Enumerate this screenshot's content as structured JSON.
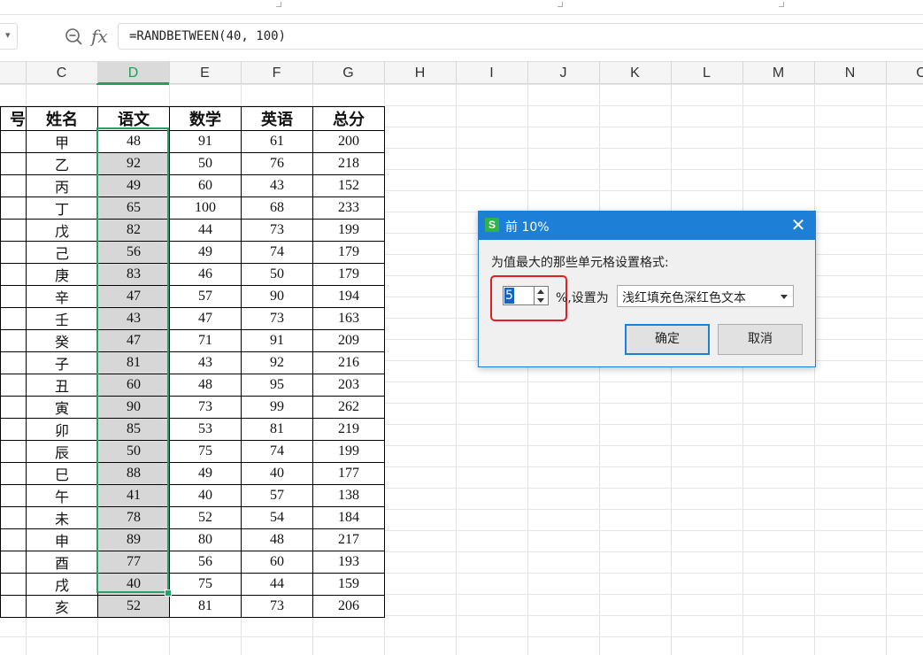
{
  "formula_bar": {
    "formula": "=RANDBETWEEN(40, 100)",
    "fx_label": "fx",
    "name_box_arrow": "▾"
  },
  "columns": [
    "C",
    "D",
    "E",
    "F",
    "G",
    "H",
    "I",
    "J",
    "K",
    "L",
    "M",
    "N",
    "O"
  ],
  "active_column": "D",
  "table": {
    "header_cut": "号",
    "headers": [
      "姓名",
      "语文",
      "数学",
      "英语",
      "总分"
    ],
    "rows": [
      [
        "甲",
        "48",
        "91",
        "61",
        "200"
      ],
      [
        "乙",
        "92",
        "50",
        "76",
        "218"
      ],
      [
        "丙",
        "49",
        "60",
        "43",
        "152"
      ],
      [
        "丁",
        "65",
        "100",
        "68",
        "233"
      ],
      [
        "戊",
        "82",
        "44",
        "73",
        "199"
      ],
      [
        "己",
        "56",
        "49",
        "74",
        "179"
      ],
      [
        "庚",
        "83",
        "46",
        "50",
        "179"
      ],
      [
        "辛",
        "47",
        "57",
        "90",
        "194"
      ],
      [
        "壬",
        "43",
        "47",
        "73",
        "163"
      ],
      [
        "癸",
        "47",
        "71",
        "91",
        "209"
      ],
      [
        "子",
        "81",
        "43",
        "92",
        "216"
      ],
      [
        "丑",
        "60",
        "48",
        "95",
        "203"
      ],
      [
        "寅",
        "90",
        "73",
        "99",
        "262"
      ],
      [
        "卯",
        "85",
        "53",
        "81",
        "219"
      ],
      [
        "辰",
        "50",
        "75",
        "74",
        "199"
      ],
      [
        "巳",
        "88",
        "49",
        "40",
        "177"
      ],
      [
        "午",
        "41",
        "40",
        "57",
        "138"
      ],
      [
        "未",
        "78",
        "52",
        "54",
        "184"
      ],
      [
        "申",
        "89",
        "80",
        "48",
        "217"
      ],
      [
        "酉",
        "77",
        "56",
        "60",
        "193"
      ],
      [
        "戌",
        "40",
        "75",
        "44",
        "159"
      ],
      [
        "亥",
        "52",
        "81",
        "73",
        "206"
      ]
    ]
  },
  "dialog": {
    "logo": "S",
    "title": "前 10%",
    "close": "✕",
    "prompt": "为值最大的那些单元格设置格式:",
    "value": "5",
    "set_as": "%,设置为",
    "format": "浅红填充色深红色文本",
    "ok": "确定",
    "cancel": "取消"
  },
  "colors": {
    "selection": "#21a366",
    "dialog_title": "#1e7fd6",
    "highlight": "#e02020",
    "range_fill": "#d7d7d7"
  }
}
